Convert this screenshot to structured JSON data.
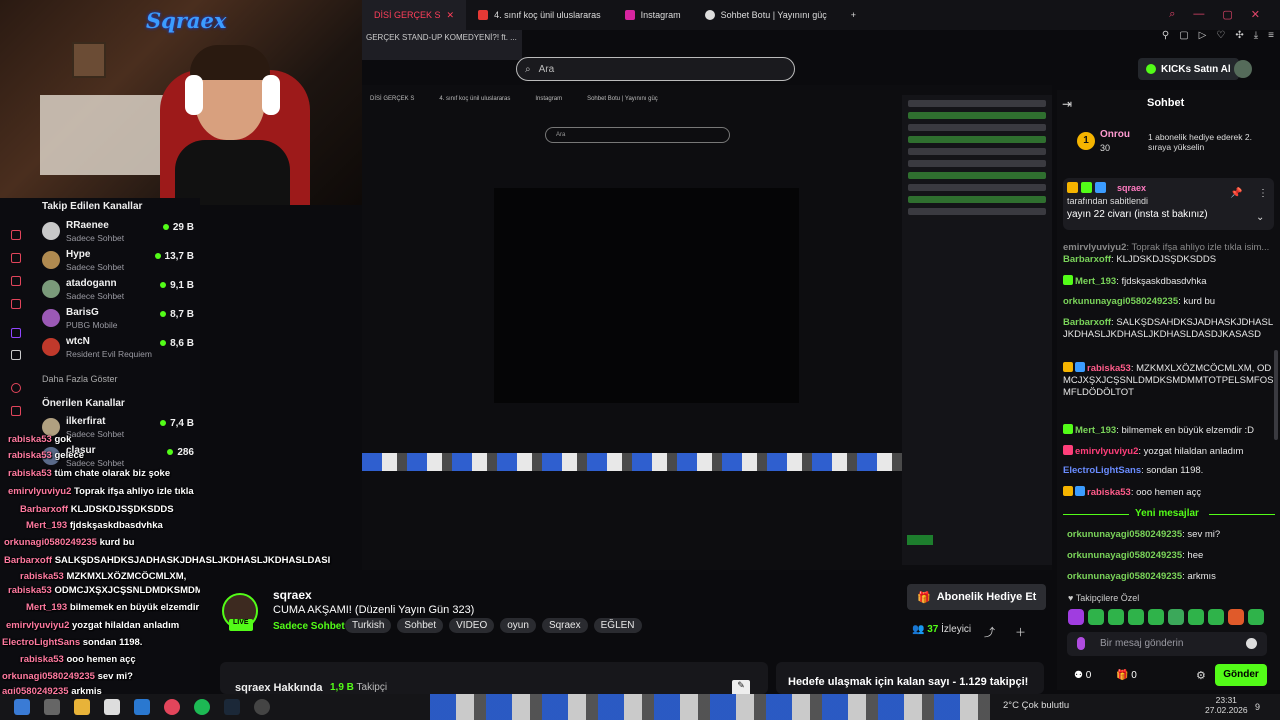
{
  "brand": "Sqraex",
  "browser": {
    "tabs": [
      {
        "label": "DİSİ GERÇEK S",
        "color": "#ff3f5a"
      },
      {
        "label": "4. sınıf koç ünil uluslararas",
        "color": "#e53935"
      },
      {
        "label": "Instagram",
        "color": "#d6249f"
      },
      {
        "label": "Sohbet Botu | Yayınını güç",
        "color": "#dddddd"
      }
    ],
    "new_tab": "+",
    "dropdown_text": "GERÇEK STAND-UP KOMEDYENİ?! ft. ...",
    "search_placeholder": "Ara",
    "window_controls": [
      "—",
      "▢",
      "✕"
    ]
  },
  "header": {
    "kicks_button": "KICKs Satın Al"
  },
  "sidebar": {
    "followed_title": "Takip Edilen Kanallar",
    "followed": [
      {
        "name": "RRaenee",
        "category": "Sadece Sohbet",
        "viewers": "29 B",
        "color": "#c8c8c8"
      },
      {
        "name": "Hype",
        "category": "Sadece Sohbet",
        "viewers": "13,7 B",
        "color": "#b08a50"
      },
      {
        "name": "atadogann",
        "category": "Sadece Sohbet",
        "viewers": "9,1 B",
        "color": "#7a9a7a"
      },
      {
        "name": "BarisG",
        "category": "PUBG Mobile",
        "viewers": "8,7 B",
        "color": "#9b59b6"
      },
      {
        "name": "wtcN",
        "category": "Resident Evil Requiem",
        "viewers": "8,6 B",
        "color": "#c0392b"
      }
    ],
    "show_more": "Daha Fazla Göster",
    "recommended_title": "Önerilen Kanallar",
    "recommended": [
      {
        "name": "ilkerfirat",
        "category": "Sadece Sohbet",
        "viewers": "7,4 B",
        "color": "#b0a080"
      },
      {
        "name": "clasur",
        "category": "Sadece Sohbet",
        "viewers": "286",
        "color": "#5a6a8a"
      }
    ]
  },
  "overlay_chat": [
    {
      "user": "rabiska53",
      "text": "gok"
    },
    {
      "user": "rabiska53",
      "text": "gelece"
    },
    {
      "user": "rabiska53",
      "text": "tüm chate olarak biz şoke"
    },
    {
      "user": "emirvlyuviyu2",
      "text": "Toprak ifşa ahliyo izle tıkla"
    },
    {
      "user": "Barbarxoff",
      "text": "KLJDSKDJSŞDKSDDS"
    },
    {
      "user": "Mert_193",
      "text": "fjdskşaskdbasdvhka"
    },
    {
      "user": "orkunagi0580249235",
      "text": "kurd bu"
    },
    {
      "user": "Barbarxoff",
      "text": "SALKŞDSAHDKSJADHASKJDHASLJKDHASLJKDHASLDASI"
    },
    {
      "user": "rabiska53",
      "text": "MZKMXLXÖZMCÖCMLXM,"
    },
    {
      "user": "rabiska53",
      "text": "ODMCJXŞXJCŞSNLDMDKSMDMMTOTPELSMFOSMFLDÖDÖLTOT"
    },
    {
      "user": "Mert_193",
      "text": "bilmemek en büyük elzemdir :D"
    },
    {
      "user": "emirvlyuviyu2",
      "text": "yozgat hilaldan anladım"
    },
    {
      "user": "ElectroLightSans",
      "text": "sondan 1198."
    },
    {
      "user": "rabiska53",
      "text": "ooo hemen açç"
    },
    {
      "user": "orkunagi0580249235",
      "text": "sev mi?"
    },
    {
      "user": "agi0580249235",
      "text": "arkmis"
    }
  ],
  "stream": {
    "streamer": "sqraex",
    "title": "CUMA AKŞAMI! (Düzenli Yayın Gün 323)",
    "category": "Sadece Sohbet",
    "tags": [
      "Turkish",
      "Sohbet",
      "VIDEO",
      "oyun",
      "Sqraex",
      "EĞLEN"
    ],
    "live_label": "LIVE",
    "sub_gift_button": "Abonelik Hediye Et",
    "viewers_count": "37",
    "viewers_label": "İzleyici",
    "about_title": "sqraex Hakkında",
    "followers_count": "1,9 B",
    "followers_label": "Takipçi",
    "goal_text": "Hedefe ulaşmak için kalan sayı - 1.129 takipçi!"
  },
  "chat": {
    "title": "Sohbet",
    "top_gifter": {
      "name": "Onrou",
      "count": "30",
      "message": "1 abonelik hediye ederek 2. sıraya yükselin"
    },
    "pinned": {
      "user": "sqraex",
      "line1": "tarafından sabitlendi",
      "line2": "yayın 22 civarı (insta st bakınız)"
    },
    "messages": [
      {
        "user": "emirvlyuviyu2",
        "text": "Toprak ifşa ahliyo izle tıkla isim...",
        "color": "#888888",
        "badges": 0
      },
      {
        "user": "Barbarxoff",
        "text": "KLJDSKDJSŞDKSDDS",
        "color": "#7ad35a",
        "badges": 0
      },
      {
        "user": "Mert_193",
        "text": "fjdskşaskdbasdvhka",
        "color": "#7ad35a",
        "badges": 1
      },
      {
        "user": "orkununayagi0580249235",
        "text": "kurd bu",
        "color": "#7ad35a",
        "badges": 0
      },
      {
        "user": "Barbarxoff",
        "text": "SALKŞDSAHDKSJADHASKJDHASLJKDHASLJKDHASLJKDHASLDASDJKASASD",
        "color": "#7ad35a",
        "badges": 0
      },
      {
        "user": "rabiska53",
        "text": "MZKMXLXÖZMCÖCMLXM, ODMCJXŞXJCŞSNLDMDKSMDMMTOTPELSMFOSMFLDÖDÖLTOT",
        "color": "#ff5c8a",
        "badges": 2
      },
      {
        "user": "Mert_193",
        "text": "bilmemek en büyük elzemdir :D",
        "color": "#7ad35a",
        "badges": 1
      },
      {
        "user": "emirvlyuviyu2",
        "text": "yozgat hilaldan anladım",
        "color": "#ff3f7a",
        "badges": 1
      },
      {
        "user": "ElectroLightSans",
        "text": "sondan 1198.",
        "color": "#6a8cff",
        "badges": 0
      },
      {
        "user": "rabiska53",
        "text": "ooo hemen açç",
        "color": "#ff5c8a",
        "badges": 2
      }
    ],
    "new_messages_label": "Yeni mesajlar",
    "new_messages": [
      {
        "user": "orkununayagi0580249235",
        "text": "sev mi?",
        "color": "#7ad35a"
      },
      {
        "user": "orkununayagi0580249235",
        "text": "hee",
        "color": "#7ad35a"
      },
      {
        "user": "orkununayagi0580249235",
        "text": "arkmıs",
        "color": "#7ad35a"
      }
    ],
    "follower_emotes_label": "Takipçilere Özel",
    "input_placeholder": "Bir mesaj gönderin",
    "points": "0",
    "send_button": "Gönder"
  },
  "taskbar": {
    "weather": "2°C  Çok bulutlu",
    "time": "23:31",
    "date": "27.02.2026",
    "notifications": "9"
  },
  "colors": {
    "accent": "#53fc18",
    "brand_blue": "#3b9cff",
    "background": "#0b0b0e"
  }
}
